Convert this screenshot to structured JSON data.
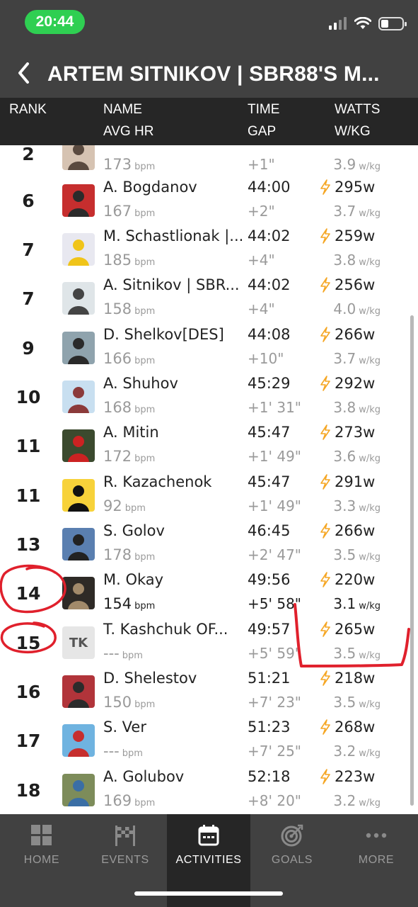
{
  "status_bar": {
    "time": "20:44"
  },
  "header": {
    "title": "ARTEM SITNIKOV | SBR88'S M..."
  },
  "columns": {
    "rank": "RANK",
    "name": "NAME",
    "avg_hr": "AVG HR",
    "time": "TIME",
    "gap": "GAP",
    "watts": "WATTS",
    "wkg": "W/KG"
  },
  "units": {
    "bpm": "bpm",
    "wkg": "w/kg"
  },
  "rows": [
    {
      "rank": "2",
      "name": "",
      "hr": "173",
      "time": "",
      "gap": "+1\"",
      "watts": "",
      "wkg": "3.9"
    },
    {
      "rank": "6",
      "name": "A. Bogdanov",
      "hr": "167",
      "time": "44:00",
      "gap": "+2\"",
      "watts": "295w",
      "wkg": "3.7"
    },
    {
      "rank": "7",
      "name": "M. Schastlionak |...",
      "hr": "185",
      "time": "44:02",
      "gap": "+4\"",
      "watts": "259w",
      "wkg": "3.8"
    },
    {
      "rank": "7",
      "name": "A. Sitnikov | SBR...",
      "hr": "158",
      "time": "44:02",
      "gap": "+4\"",
      "watts": "256w",
      "wkg": "4.0"
    },
    {
      "rank": "9",
      "name": "D. Shelkov[DES]",
      "hr": "166",
      "time": "44:08",
      "gap": "+10\"",
      "watts": "266w",
      "wkg": "3.7"
    },
    {
      "rank": "10",
      "name": "A. Shuhov",
      "hr": "168",
      "time": "45:29",
      "gap": "+1' 31\"",
      "watts": "292w",
      "wkg": "3.8"
    },
    {
      "rank": "11",
      "name": "A. Mitin",
      "hr": "172",
      "time": "45:47",
      "gap": "+1' 49\"",
      "watts": "273w",
      "wkg": "3.6"
    },
    {
      "rank": "11",
      "name": "R. Kazachenok",
      "hr": "92",
      "time": "45:47",
      "gap": "+1' 49\"",
      "watts": "291w",
      "wkg": "3.3"
    },
    {
      "rank": "13",
      "name": "S. Golov",
      "hr": "178",
      "time": "46:45",
      "gap": "+2' 47\"",
      "watts": "266w",
      "wkg": "3.5"
    },
    {
      "rank": "14",
      "name": "M. Okay",
      "hr": "154",
      "time": "49:56",
      "gap": "+5' 58\"",
      "watts": "220w",
      "wkg": "3.1"
    },
    {
      "rank": "15",
      "name": "T. Kashchuk  OF...",
      "hr": "---",
      "time": "49:57",
      "gap": "+5' 59\"",
      "watts": "265w",
      "wkg": "3.5",
      "initials": "TK"
    },
    {
      "rank": "16",
      "name": "D. Shelestov",
      "hr": "150",
      "time": "51:21",
      "gap": "+7' 23\"",
      "watts": "218w",
      "wkg": "3.5"
    },
    {
      "rank": "17",
      "name": "S. Ver",
      "hr": "---",
      "time": "51:23",
      "gap": "+7' 25\"",
      "watts": "268w",
      "wkg": "3.2"
    },
    {
      "rank": "18",
      "name": "A. Golubov",
      "hr": "169",
      "time": "52:18",
      "gap": "+8' 20\"",
      "watts": "223w",
      "wkg": "3.2"
    }
  ],
  "tabs": [
    {
      "label": "HOME",
      "icon": "grid-icon"
    },
    {
      "label": "EVENTS",
      "icon": "checkered-flag-icon"
    },
    {
      "label": "ACTIVITIES",
      "icon": "calendar-icon",
      "active": true
    },
    {
      "label": "GOALS",
      "icon": "target-icon"
    },
    {
      "label": "MORE",
      "icon": "more-dots-icon"
    }
  ],
  "colors": {
    "header_bg": "#414141",
    "colhead_bg": "#262626",
    "bolt": "#f5a623",
    "annotation": "#e0202c",
    "time_pill": "#2fcf52"
  }
}
